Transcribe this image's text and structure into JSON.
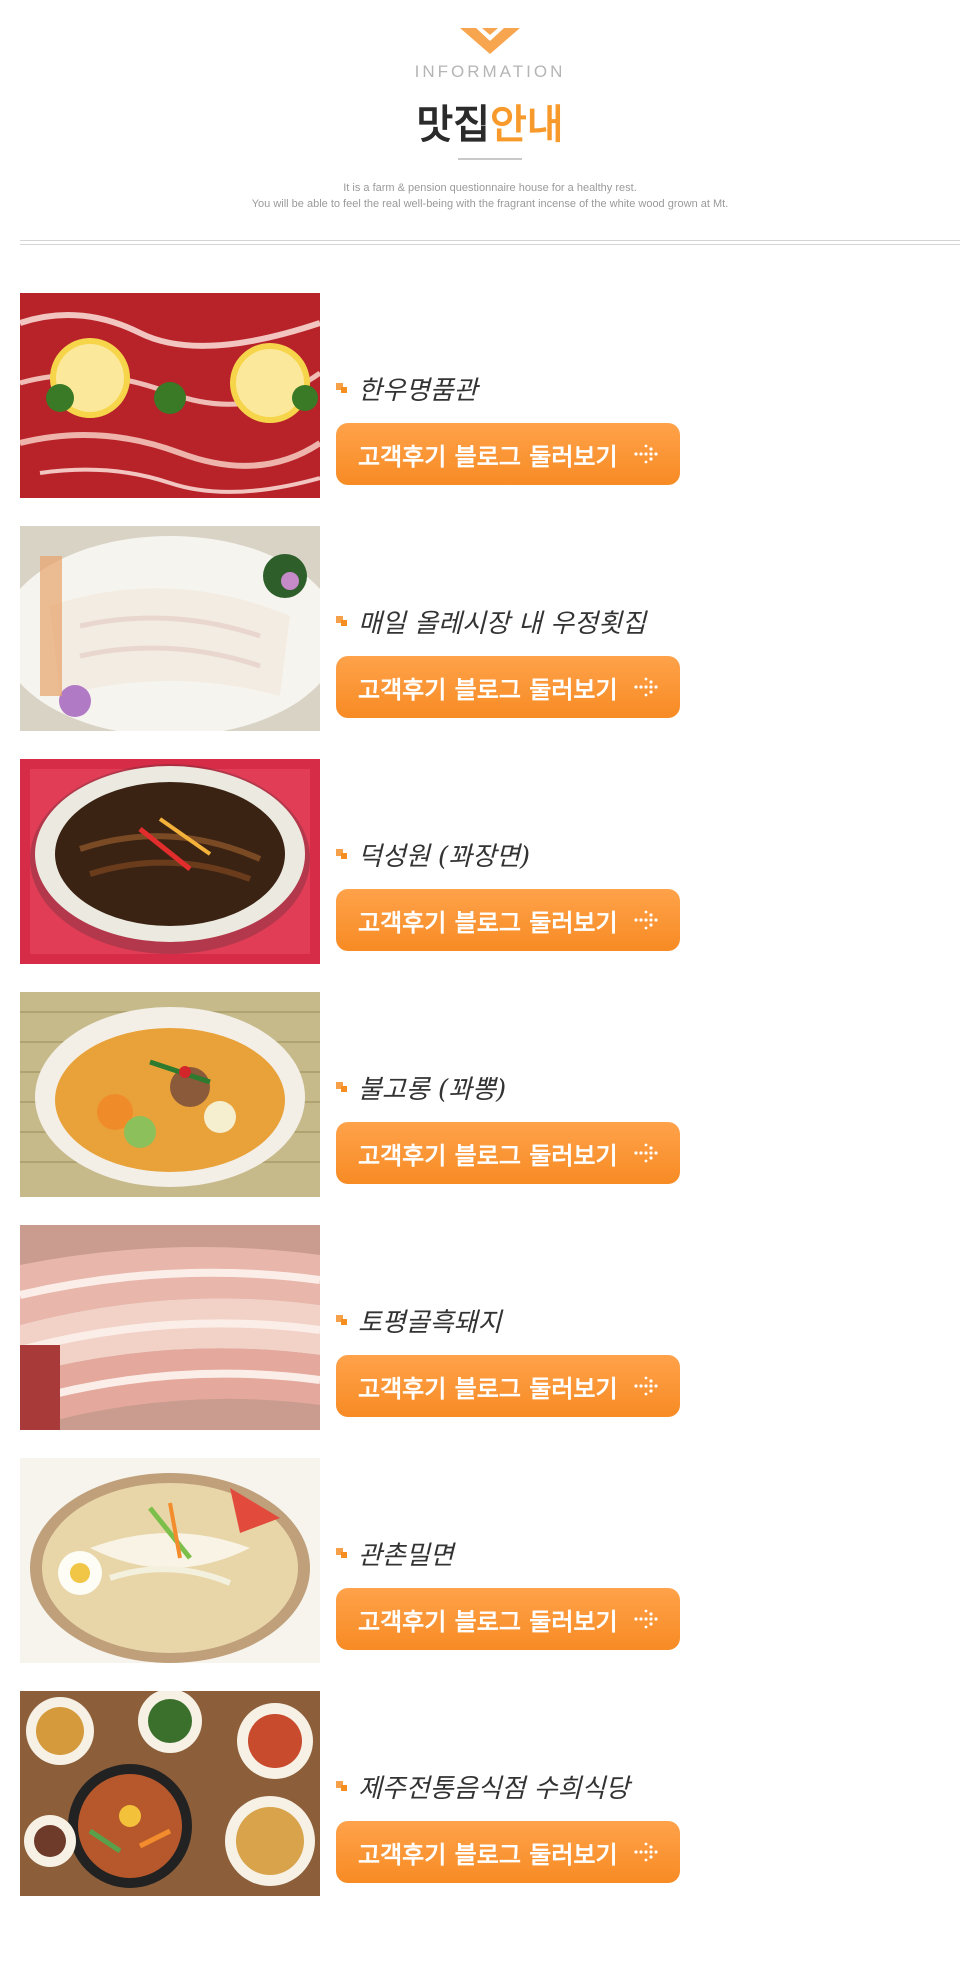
{
  "header": {
    "kicker": "INFORMATION",
    "title_main": "맛집",
    "title_accent": "안내",
    "desc_line1": "It is a farm & pension questionnaire house for a healthy rest.",
    "desc_line2": "You will be able to feel the real well-being with the fragrant incense of the white wood grown at Mt."
  },
  "colors": {
    "accent": "#f79a2b",
    "button": "#f78b24",
    "text": "#2b2b2b"
  },
  "restaurants": [
    {
      "name": "한우명품관",
      "button_label": "고객후기 블로그 둘러보기",
      "photo": "marbled-beef-with-lemon",
      "button_icon": "dotted-arrow-icon"
    },
    {
      "name": "매일 올레시장 내 우정횟집",
      "button_label": "고객후기 블로그 둘러보기",
      "photo": "sliced-raw-fish",
      "button_icon": "dotted-arrow-icon"
    },
    {
      "name": "덕성원 (꽈장면)",
      "button_label": "고객후기 블로그 둘러보기",
      "photo": "jajangmyeon-bowl",
      "button_icon": "dotted-arrow-icon"
    },
    {
      "name": "불고롱 (꽈뽕)",
      "button_label": "고객후기 블로그 둘러보기",
      "photo": "jjamppong-bowl",
      "button_icon": "dotted-arrow-icon"
    },
    {
      "name": "토평골흑돼지",
      "button_label": "고객후기 블로그 둘러보기",
      "photo": "black-pork-slices",
      "button_icon": "dotted-arrow-icon"
    },
    {
      "name": "관촌밀면",
      "button_label": "고객후기 블로그 둘러보기",
      "photo": "cold-wheat-noodles",
      "button_icon": "dotted-arrow-icon"
    },
    {
      "name": "제주전통음식점 수희식당",
      "button_label": "고객후기 블로그 둘러보기",
      "photo": "bibimbap-table-set",
      "button_icon": "dotted-arrow-icon"
    }
  ]
}
